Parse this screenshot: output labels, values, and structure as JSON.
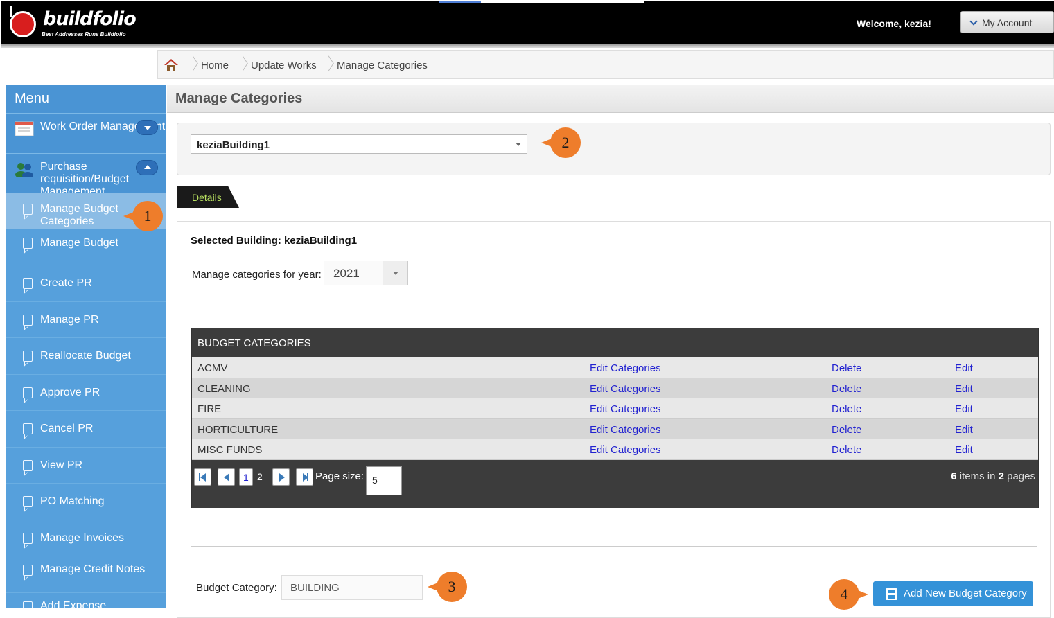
{
  "header": {
    "logo_text": "buildfolio",
    "logo_tagline": "Best Addresses Runs Buildfolio",
    "welcome": "Welcome, kezia!",
    "account_label": "My Account"
  },
  "breadcrumb": [
    "Home",
    "Update Works",
    "Manage Categories"
  ],
  "sidebar": {
    "title": "Menu",
    "groups": [
      {
        "label": "Work Order Management",
        "expanded": false
      },
      {
        "label": "Purchase requisition/Budget Management",
        "expanded": true
      }
    ],
    "items": [
      {
        "label": "Manage Budget Categories",
        "active": true
      },
      {
        "label": "Manage Budget"
      },
      {
        "label": "Create PR"
      },
      {
        "label": "Manage PR"
      },
      {
        "label": "Reallocate Budget"
      },
      {
        "label": "Approve PR"
      },
      {
        "label": "Cancel PR"
      },
      {
        "label": "View PR"
      },
      {
        "label": "PO Matching"
      },
      {
        "label": "Manage Invoices"
      },
      {
        "label": "Manage Credit Notes"
      },
      {
        "label": "Add Expense"
      }
    ]
  },
  "main": {
    "title": "Manage Categories",
    "building_select": "keziaBuilding1",
    "tab_label": "Details",
    "selected_building": "Selected Building: keziaBuilding1",
    "year_label": "Manage categories for year:",
    "year_value": "2021",
    "grid": {
      "header": "BUDGET CATEGORIES",
      "rows": [
        {
          "name": "ACMV",
          "edit_categories": "Edit Categories",
          "delete": "Delete",
          "edit": "Edit"
        },
        {
          "name": "CLEANING",
          "edit_categories": "Edit Categories",
          "delete": "Delete",
          "edit": "Edit"
        },
        {
          "name": "FIRE",
          "edit_categories": "Edit Categories",
          "delete": "Delete",
          "edit": "Edit"
        },
        {
          "name": "HORTICULTURE",
          "edit_categories": "Edit Categories",
          "delete": "Delete",
          "edit": "Edit"
        },
        {
          "name": "MISC FUNDS",
          "edit_categories": "Edit Categories",
          "delete": "Delete",
          "edit": "Edit"
        }
      ],
      "pager": {
        "pages": [
          "1",
          "2"
        ],
        "current_page": "1",
        "page_size_label": "Page size:",
        "page_size": "5",
        "items_count": "6",
        "items_text_1": " items in ",
        "pages_count": "2",
        "items_text_2": " pages"
      }
    },
    "category_label": "Budget Category:",
    "category_value": "BUILDING",
    "add_button": "Add New Budget Category"
  },
  "annotations": [
    "1",
    "2",
    "3",
    "4"
  ],
  "colors": {
    "accent_orange": "#ee7d2b",
    "sidebar_blue": "#56a0dc",
    "button_blue": "#3492d8",
    "link_blue": "#2222d0",
    "brand_red": "#d81e1e"
  }
}
